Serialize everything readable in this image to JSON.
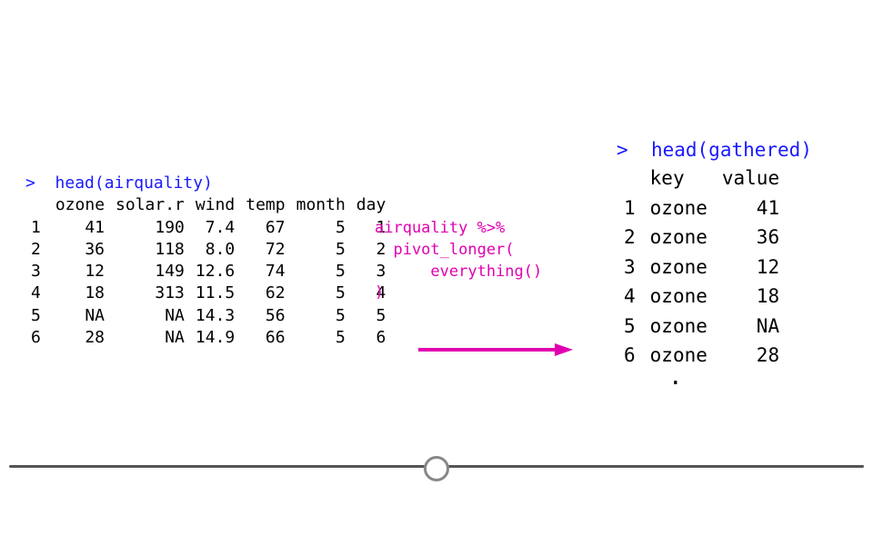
{
  "left": {
    "prompt_gt": ">",
    "prompt_cmd": "head(airquality)",
    "cols": [
      "ozone",
      "solar.r",
      "wind",
      "temp",
      "month",
      "day"
    ],
    "rows": [
      {
        "idx": "1",
        "ozone": "41",
        "solar": "190",
        "wind": "7.4",
        "temp": "67",
        "month": "5",
        "day": "1"
      },
      {
        "idx": "2",
        "ozone": "36",
        "solar": "118",
        "wind": "8.0",
        "temp": "72",
        "month": "5",
        "day": "2"
      },
      {
        "idx": "3",
        "ozone": "12",
        "solar": "149",
        "wind": "12.6",
        "temp": "74",
        "month": "5",
        "day": "3"
      },
      {
        "idx": "4",
        "ozone": "18",
        "solar": "313",
        "wind": "11.5",
        "temp": "62",
        "month": "5",
        "day": "4"
      },
      {
        "idx": "5",
        "ozone": "NA",
        "solar": "NA",
        "wind": "14.3",
        "temp": "56",
        "month": "5",
        "day": "5"
      },
      {
        "idx": "6",
        "ozone": "28",
        "solar": "NA",
        "wind": "14.9",
        "temp": "66",
        "month": "5",
        "day": "6"
      }
    ]
  },
  "mid": {
    "line1": "airquality %>%",
    "line2": "  pivot_longer(",
    "line3": "      everything()",
    "line4": ")"
  },
  "arrow_color": "#e100b0",
  "right": {
    "prompt_gt": ">",
    "prompt_cmd": "head(gathered)",
    "col_key": "key",
    "col_value": "value",
    "rows": [
      {
        "idx": "1",
        "key": "ozone",
        "value": "41"
      },
      {
        "idx": "2",
        "key": "ozone",
        "value": "36"
      },
      {
        "idx": "3",
        "key": "ozone",
        "value": "12"
      },
      {
        "idx": "4",
        "key": "ozone",
        "value": "18"
      },
      {
        "idx": "5",
        "key": "ozone",
        "value": "NA"
      },
      {
        "idx": "6",
        "key": "ozone",
        "value": "28"
      }
    ],
    "truncation_indicator": "."
  },
  "slider": {
    "percent": 50
  }
}
